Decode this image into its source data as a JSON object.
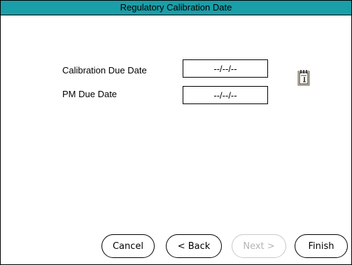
{
  "window": {
    "title": "Regulatory Calibration Date",
    "title_color": "#1a9ea8"
  },
  "form": {
    "calibration_due": {
      "label": "Calibration Due Date",
      "value": "--/--/--"
    },
    "pm_due": {
      "label": "PM Due Date",
      "value": "--/--/--"
    },
    "calendar_icon": "calendar-icon"
  },
  "buttons": {
    "cancel": "Cancel",
    "back": "< Back",
    "next": "Next >",
    "finish": "Finish"
  }
}
